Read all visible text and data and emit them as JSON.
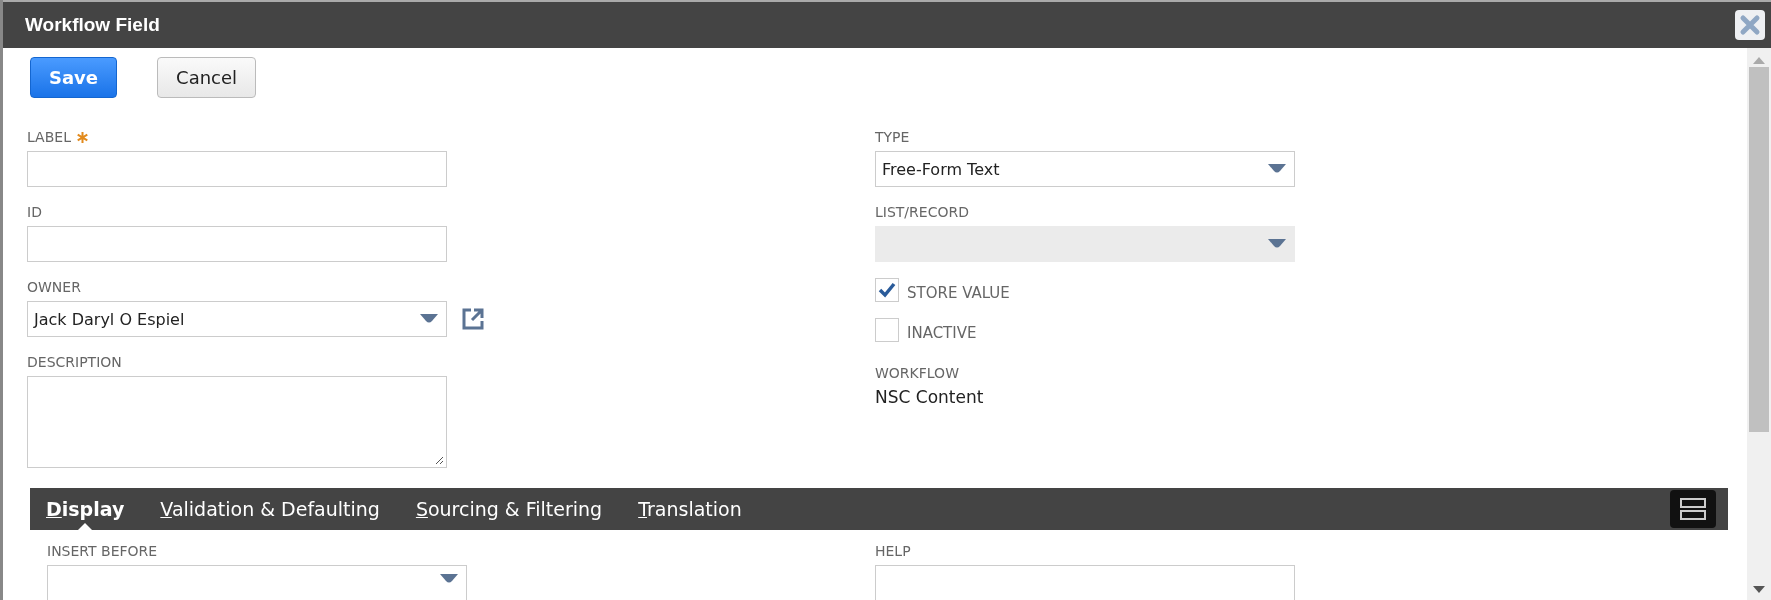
{
  "window": {
    "title": "Workflow Field"
  },
  "buttons": [
    {
      "label": "Save",
      "kind": "primary"
    },
    {
      "label": "Cancel",
      "kind": "secondary"
    }
  ],
  "left_fields": [
    {
      "label": "LABEL",
      "required": true,
      "kind": "text"
    },
    {
      "label": "ID",
      "required": false,
      "kind": "text"
    },
    {
      "label": "OWNER",
      "required": false,
      "kind": "select",
      "value": "Jack Daryl O Espiel"
    },
    {
      "label": "DESCRIPTION",
      "required": false,
      "kind": "textarea"
    }
  ],
  "right_fields": [
    {
      "label": "TYPE",
      "kind": "select",
      "value": "Free-Form Text",
      "disabled": false
    },
    {
      "label": "LIST/RECORD",
      "kind": "select",
      "disabled": true
    },
    {
      "label": "STORE VALUE",
      "kind": "checkbox",
      "checked": true
    },
    {
      "label": "INACTIVE",
      "kind": "checkbox",
      "checked": false
    },
    {
      "label": "WORKFLOW",
      "kind": "static",
      "value": "NSC Content"
    }
  ],
  "tabs": [
    {
      "label": "Display",
      "selected": true
    },
    {
      "label": "Validation & Defaulting",
      "selected": false
    },
    {
      "label": "Sourcing & Filtering",
      "selected": false
    },
    {
      "label": "Translation",
      "selected": false
    }
  ],
  "tab_fields": [
    {
      "label": "INSERT BEFORE",
      "kind": "select"
    },
    {
      "label": "HELP",
      "kind": "text"
    }
  ]
}
